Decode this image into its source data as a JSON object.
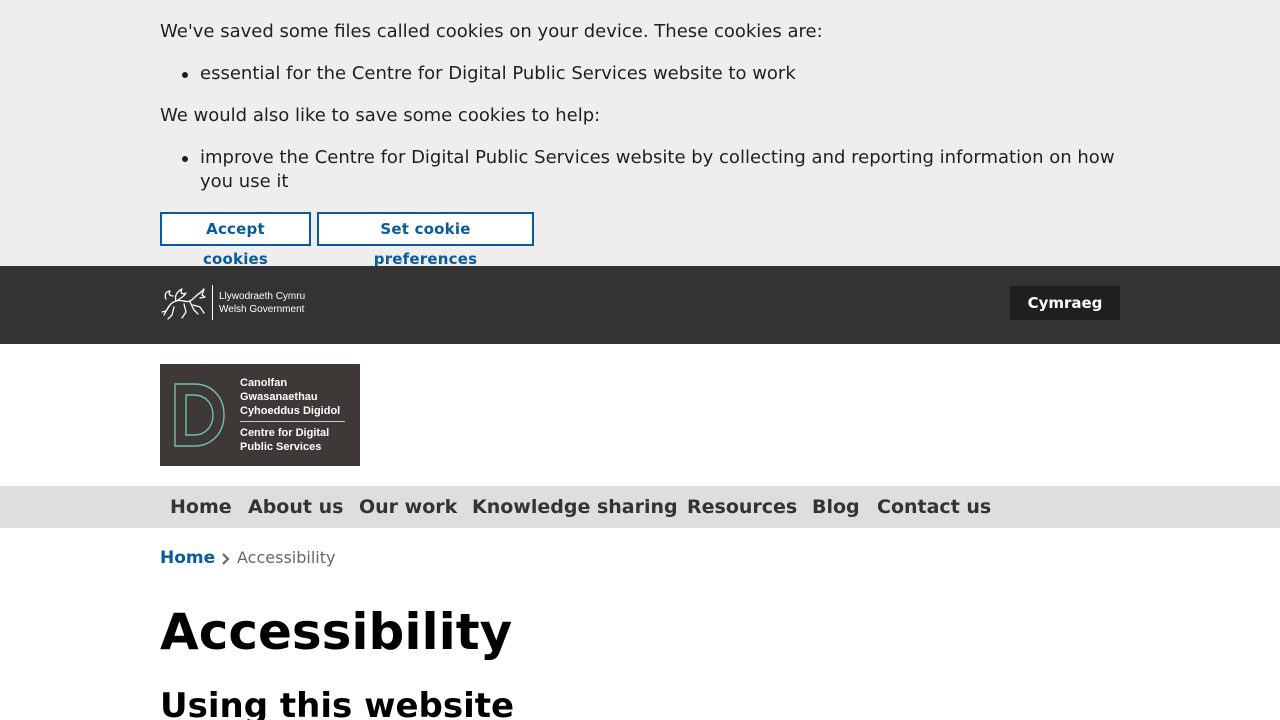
{
  "cookie_banner": {
    "intro": "We've saved some files called cookies on your device. These cookies are:",
    "essential_items": [
      "essential for the Centre for Digital Public Services website to work"
    ],
    "optional_intro": "We would also like to save some cookies to help:",
    "optional_items": [
      "improve the Centre for Digital Public Services website by collecting and reporting information on how you use it"
    ],
    "accept_label": "Accept cookies",
    "preferences_label": "Set cookie preferences"
  },
  "gov_header": {
    "logo_welsh": "Llywodraeth Cymru",
    "logo_english": "Welsh Government",
    "language_toggle": "Cymraeg"
  },
  "site_logo": {
    "welsh_lines": [
      "Canolfan",
      "Gwasanaethau",
      "Cyhoeddus Digidol"
    ],
    "english_lines": [
      "Centre for Digital",
      "Public Services"
    ]
  },
  "nav": {
    "items": [
      "Home",
      "About us",
      "Our work",
      "Knowledge sharing",
      "Resources",
      "Blog",
      "Contact us"
    ]
  },
  "breadcrumb": {
    "home": "Home",
    "current": "Accessibility"
  },
  "page": {
    "title": "Accessibility",
    "section_heading": "Using this website"
  },
  "colors": {
    "banner_bg": "#eeeeee",
    "link_blue": "#0a5b9c",
    "header_dark": "#333333",
    "nav_bg": "#dedede",
    "logo_bg": "#3e3837",
    "logo_accent": "#6fc2b0"
  },
  "icons": {
    "gov_logo": "welsh-dragon-icon",
    "site_logo_mark": "letter-d-icon",
    "breadcrumb_separator": "chevron-right-icon"
  }
}
